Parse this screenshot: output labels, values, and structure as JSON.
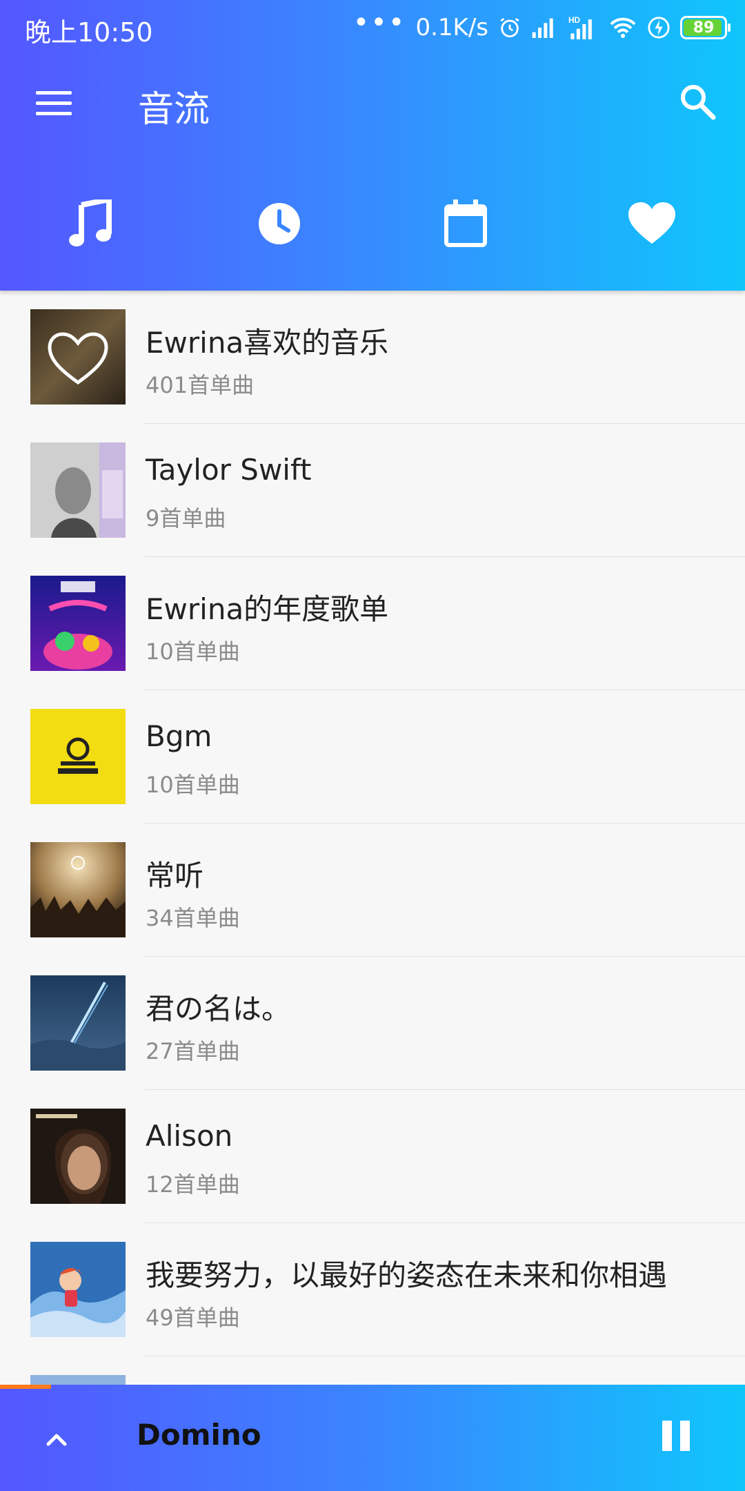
{
  "statusbar": {
    "time": "晚上10:50",
    "dots": "•••",
    "net_speed": "0.1K/s",
    "battery": "89"
  },
  "toolbar": {
    "title": "音流"
  },
  "tabs": [
    {
      "icon": "music-note-icon"
    },
    {
      "icon": "clock-icon"
    },
    {
      "icon": "calendar-icon"
    },
    {
      "icon": "heart-icon"
    }
  ],
  "playlists": [
    {
      "name": "Ewrina喜欢的音乐",
      "count": "401首单曲"
    },
    {
      "name": "Taylor Swift",
      "count": "9首单曲"
    },
    {
      "name": "Ewrina的年度歌单",
      "count": "10首单曲"
    },
    {
      "name": "Bgm",
      "count": "10首单曲"
    },
    {
      "name": "常听",
      "count": "34首单曲"
    },
    {
      "name": "君の名は。",
      "count": "27首单曲"
    },
    {
      "name": "Alison",
      "count": "12首单曲"
    },
    {
      "name": "我要努力，以最好的姿态在未来和你相遇",
      "count": "49首单曲"
    }
  ],
  "player": {
    "song": "Domino"
  },
  "colors": {
    "header_start": "#5457ff",
    "header_end": "#0fc6fb",
    "progress": "#ff7a1a"
  }
}
